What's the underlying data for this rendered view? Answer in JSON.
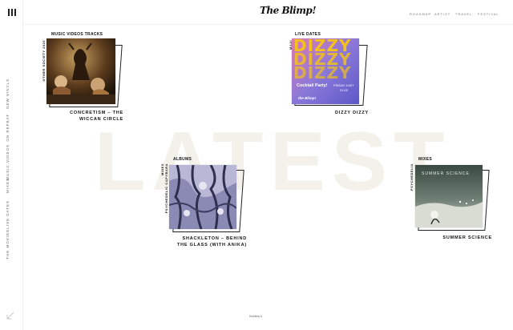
{
  "sidebar": {
    "items": [
      {
        "label": "NEW VINYLS"
      },
      {
        "label": "ON REPEAT"
      },
      {
        "label": "MUSIC VIDEOS"
      },
      {
        "label": "MIXES"
      },
      {
        "label": "LIVE DATES"
      },
      {
        "label": "THE MOVIES"
      }
    ]
  },
  "header": {
    "logo": "The Blimp!",
    "nav": [
      "ROADMAP",
      "ARTIST",
      "TRAVEL",
      "FESTIVAL"
    ]
  },
  "background_word": "LATEST",
  "cards": [
    {
      "category": "MUSIC VIDEOS TRACKS",
      "side_label": "OTHER SOCIETY 2020",
      "title_lines": [
        "CONCRETISM – THE",
        "WICCAN CIRCLE"
      ]
    },
    {
      "category": "LIVE DATES",
      "side_label": "MAXI",
      "title_lines": [
        "DIZZY DIZZY"
      ],
      "poster": {
        "headline": "DIZZY",
        "sub": "Cocktail Party!",
        "date_line": "FRIDAY 14/07",
        "time": "21:00",
        "brand": "the Blimp!"
      }
    },
    {
      "category": "ALBUMS",
      "side_label": "PSYCHEDELIC CAPYBARA",
      "side_label2": "MIXES",
      "title_lines": [
        "SHACKLETON – BEHIND",
        "THE GLASS (WITH ANIKA)"
      ]
    },
    {
      "category": "MIXES",
      "side_label": "PSYCHEDELIA",
      "title_lines": [
        "SUMMER SCIENCE"
      ],
      "cover_text": "SUMMER SCIENCE"
    }
  ],
  "footer": {
    "tag": "theblimp.it"
  },
  "colors": {
    "poster_bg": "#7a6fd0",
    "poster_text": "#f2c11b",
    "frame": "#222222",
    "bigword": "#f4f1eb"
  }
}
